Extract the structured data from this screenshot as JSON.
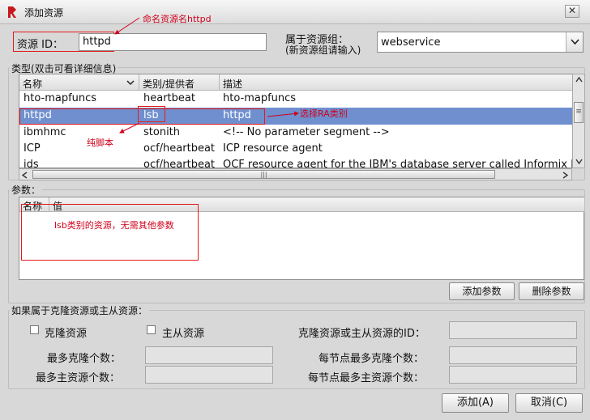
{
  "window": {
    "title": "添加资源",
    "close_glyph": "✕"
  },
  "resource_id": {
    "label": "资源 ID：",
    "value": "httpd"
  },
  "group": {
    "label_line1": "属于资源组：",
    "label_line2": "(新资源组请输入)",
    "value": "webservice"
  },
  "type_section": {
    "title": "类型(双击可看详细信息)",
    "columns": [
      "名称",
      "类别/提供者",
      "描述"
    ],
    "rows": [
      {
        "name": "hto-mapfuncs",
        "provider": "heartbeat",
        "desc": "hto-mapfuncs",
        "selected": false
      },
      {
        "name": "httpd",
        "provider": "lsb",
        "desc": "httpd",
        "selected": true
      },
      {
        "name": "ibmhmc",
        "provider": "stonith",
        "desc": "<!-- No parameter segment -->",
        "selected": false
      },
      {
        "name": "ICP",
        "provider": "ocf/heartbeat",
        "desc": "ICP resource agent",
        "selected": false
      },
      {
        "name": "ids",
        "provider": "ocf/heartbeat",
        "desc": "OCF resource agent for the IBM's database server called Informix Dy",
        "selected": false
      }
    ],
    "hscroll_grip": "|||",
    "vscroll_grip": "≡"
  },
  "params_section": {
    "title": "参数：",
    "columns": [
      "名称",
      "值"
    ],
    "add_button": "添加参数",
    "delete_button": "删除参数"
  },
  "clone_section": {
    "title": "如果属于克隆资源或主从资源：",
    "clone_checkbox": "克隆资源",
    "master_checkbox": "主从资源",
    "clone_id_label": "克隆资源或主从资源的ID：",
    "max_clone_label": "最多克隆个数：",
    "max_master_label": "最多主资源个数：",
    "node_max_clone_label": "每节点最多克隆个数：",
    "node_max_master_label": "每节点最多主资源个数："
  },
  "footer": {
    "add_button": "添加(A)",
    "cancel_button": "取消(C)"
  },
  "annotations": {
    "name_note": "命名资源名httpd",
    "ra_note": "选择RA类别",
    "script_note": "纯脚本",
    "params_note": "lsb类别的资源，无需其他参数"
  },
  "colors": {
    "selection": "#6f8fcf",
    "annotation": "#d0021b"
  }
}
